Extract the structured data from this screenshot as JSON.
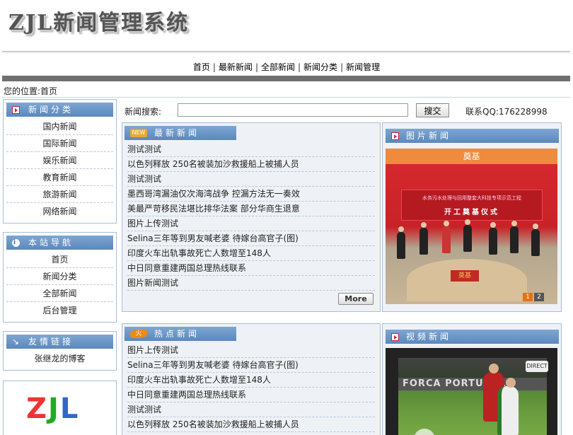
{
  "site": {
    "logo_text": "ZJL新闻管理系统"
  },
  "topnav": [
    "首页",
    "最新新闻",
    "全部新闻",
    "新闻分类",
    "新闻管理"
  ],
  "location": "您的位置:首页",
  "sidebar": {
    "categories": {
      "title": "新闻分类",
      "icon": "arrow-icon",
      "items": [
        "国内新闻",
        "国际新闻",
        "娱乐新闻",
        "教育新闻",
        "旅游新闻",
        "网络新闻"
      ]
    },
    "site_nav": {
      "title": "本站导航",
      "icon": "info-icon",
      "items": [
        "首页",
        "新闻分类",
        "全部新闻",
        "后台管理"
      ]
    },
    "links": {
      "title": "友情链接",
      "icon": "link-icon",
      "items": [
        "张继龙的博客"
      ]
    },
    "bottom_logo": [
      "Z",
      "J",
      "L"
    ]
  },
  "search": {
    "label": "新闻搜索:",
    "value": "",
    "button": "搜交",
    "qq": "联系QQ:176228998"
  },
  "latest": {
    "title": "最新新闻",
    "icon_text": "NEW",
    "items": [
      "测试测试",
      "以色列释放 250名被装加沙救援船上被捕人员",
      "测试测试",
      "墨西哥湾漏油仅次海湾战争 控漏方法无一奏效",
      "美最严苛移民法堪比排华法案 部分华商生退意",
      "图片上传测试",
      "Selina三年等到男友喊老婆 待嫁台高官子(图)",
      "印度火车出轨事故死亡人数增至148人",
      "中日同意重建两国总理热线联系",
      "图片新闻测试"
    ],
    "more": "More"
  },
  "pic_news": {
    "title": "图片新闻",
    "caption": "奠基",
    "banner_line1": "水务污水处理与回用整套大科技专项示范工程",
    "banner_line2": "开工奠基仪式",
    "stone_text": "奠基",
    "pager": [
      "1",
      "2"
    ]
  },
  "hot": {
    "title": "热点新闻",
    "icon_text": "火",
    "items": [
      "图片上传测试",
      "Selina三年等到男友喊老婆 待嫁台高官子(图)",
      "印度火车出轨事故死亡人数增至148人",
      "中日同意重建两国总理热线联系",
      "测试测试",
      "以色列释放 250名被装加沙救援船上被捕人员"
    ]
  },
  "video_news": {
    "title": "视频新闻",
    "ad_text": "FORCA PORTUGAL",
    "badge": "DIRECT"
  },
  "colors": {
    "title_bar": "#6b96c8",
    "accent_orange": "#f08a3c",
    "border": "#a9bed4"
  }
}
